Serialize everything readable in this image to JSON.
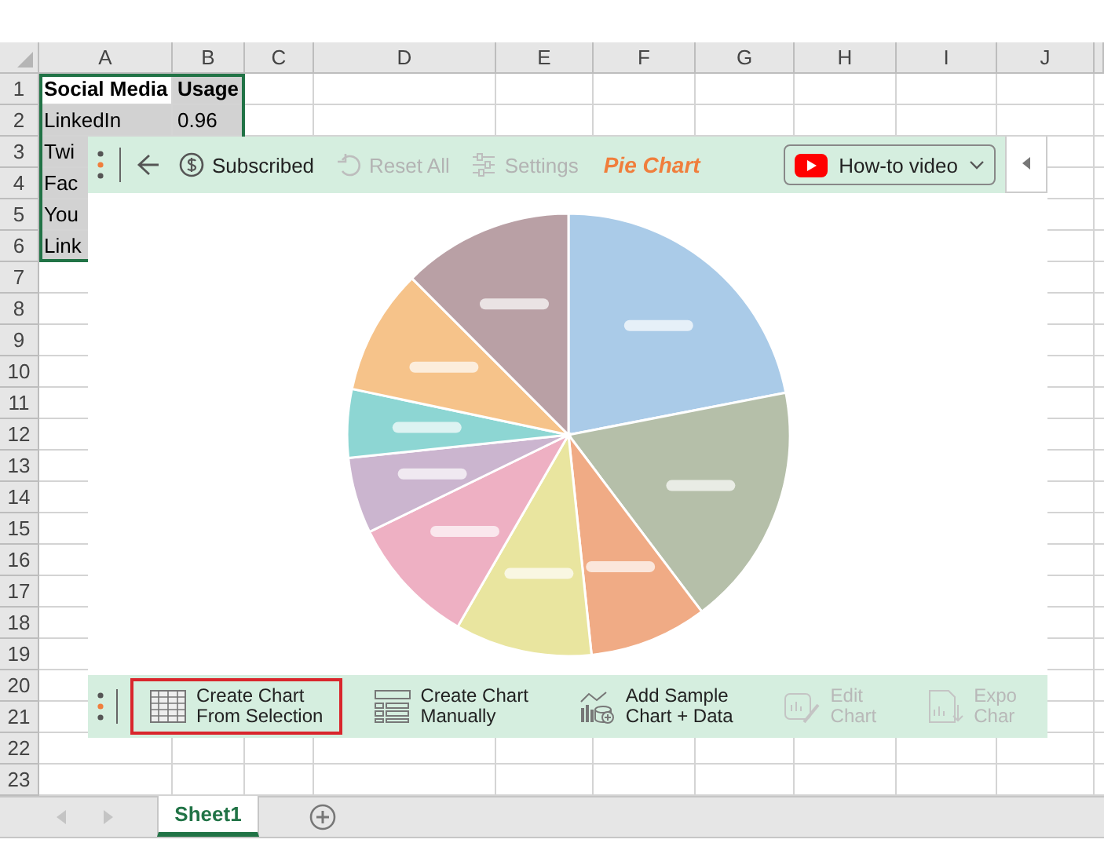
{
  "sheet": {
    "columns": [
      "A",
      "B",
      "C",
      "D",
      "E",
      "F",
      "G",
      "H",
      "I",
      "J"
    ],
    "row_numbers": [
      "1",
      "2",
      "3",
      "4",
      "5",
      "6",
      "7",
      "8",
      "9",
      "10",
      "11",
      "12",
      "13",
      "14",
      "15",
      "16",
      "17",
      "18",
      "19",
      "20",
      "21",
      "22",
      "23"
    ],
    "data_rows": [
      [
        {
          "text": "Social Media",
          "bold": true,
          "highlighted": false
        },
        {
          "text": "Usage",
          "bold": true,
          "highlighted": true
        }
      ],
      [
        {
          "text": "LinkedIn",
          "bold": false,
          "highlighted": true
        },
        {
          "text": "0.96",
          "bold": false,
          "highlighted": true
        }
      ],
      [
        {
          "text": "Twi",
          "bold": false,
          "highlighted": true
        }
      ],
      [
        {
          "text": "Fac",
          "bold": false,
          "highlighted": true
        }
      ],
      [
        {
          "text": "You",
          "bold": false,
          "highlighted": true
        }
      ],
      [
        {
          "text": "Link",
          "bold": false,
          "highlighted": true
        }
      ]
    ]
  },
  "panel": {
    "toolbar": {
      "items": [
        {
          "kind": "subscribed",
          "label": "Subscribed",
          "disabled": false
        },
        {
          "kind": "reset",
          "label": "Reset All",
          "disabled": true
        },
        {
          "kind": "settings",
          "label": "Settings",
          "disabled": true
        }
      ],
      "title": "Pie Chart",
      "video_button": {
        "label": "How-to video"
      }
    },
    "actions": [
      {
        "kind": "table",
        "lines": [
          "Create Chart",
          "From Selection"
        ],
        "selected": true,
        "disabled": false
      },
      {
        "kind": "form",
        "lines": [
          "Create Chart",
          "Manually"
        ],
        "selected": false,
        "disabled": false
      },
      {
        "kind": "sample",
        "lines": [
          "Add Sample",
          "Chart + Data"
        ],
        "selected": false,
        "disabled": false
      },
      {
        "kind": "edit",
        "lines": [
          "Edit",
          "Chart"
        ],
        "selected": false,
        "disabled": true
      },
      {
        "kind": "export",
        "lines": [
          "Expo",
          "Char"
        ],
        "selected": false,
        "disabled": true
      }
    ]
  },
  "sheet_tabs": [
    {
      "label": "Sheet1",
      "selected": true
    }
  ]
}
